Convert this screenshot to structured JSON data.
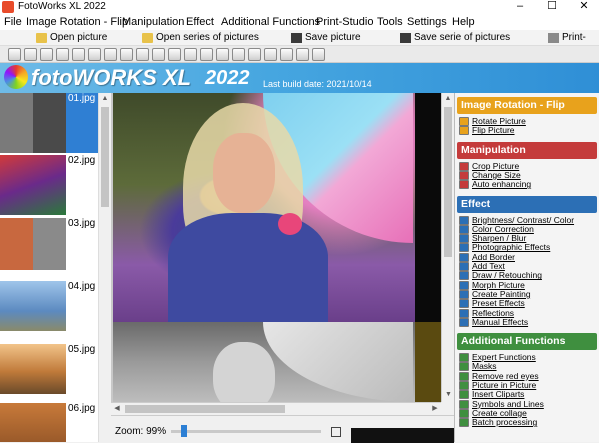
{
  "window": {
    "title": "FotoWorks XL 2022",
    "controls": [
      "–",
      "☐",
      "✕"
    ]
  },
  "menu": [
    "File",
    "Image Rotation - Flip",
    "Manipulation",
    "Effect",
    "Additional Functions",
    "Print-Studio",
    "Tools",
    "Settings",
    "Help"
  ],
  "toolbar": {
    "open_picture": "Open picture",
    "open_series": "Open series of pictures",
    "save_picture": "Save picture",
    "save_series": "Save serie of pictures",
    "print": "Print-Stu"
  },
  "banner": {
    "brand": "fotoWORKS XL",
    "version": "2022",
    "build": "Last build date: 2021/10/14"
  },
  "thumbnails": [
    "01.jpg",
    "02.jpg",
    "03.jpg",
    "04.jpg",
    "05.jpg",
    "06.jpg"
  ],
  "status": {
    "zoom": "Zoom: 99%"
  },
  "panel": {
    "sections": [
      {
        "title": "Image Rotation - Flip",
        "color": "#e8a21c",
        "items": [
          "Rotate Picture",
          "Flip Picture"
        ]
      },
      {
        "title": "Manipulation",
        "color": "#c43b3b",
        "items": [
          "Crop Picture",
          "Change Size",
          "Auto enhancing"
        ]
      },
      {
        "title": "Effect",
        "color": "#2c6fb5",
        "items": [
          "Brightness/ Contrast/ Color",
          "Color Correction",
          "Sharpen / Blur",
          "Photographic Effects",
          "Add Border",
          "Add Text",
          "Draw / Retouching",
          "Morph Picture",
          "Create Painting",
          "Preset Effects",
          "Reflections",
          "Manual Effects"
        ]
      },
      {
        "title": "Additional Functions",
        "color": "#3f8f3f",
        "items": [
          "Expert Functions",
          "Masks",
          "Remove red eyes",
          "Picture in Picture",
          "Insert Cliparts",
          "Symbols and Lines",
          "Create collage",
          "Batch processing"
        ]
      }
    ]
  }
}
